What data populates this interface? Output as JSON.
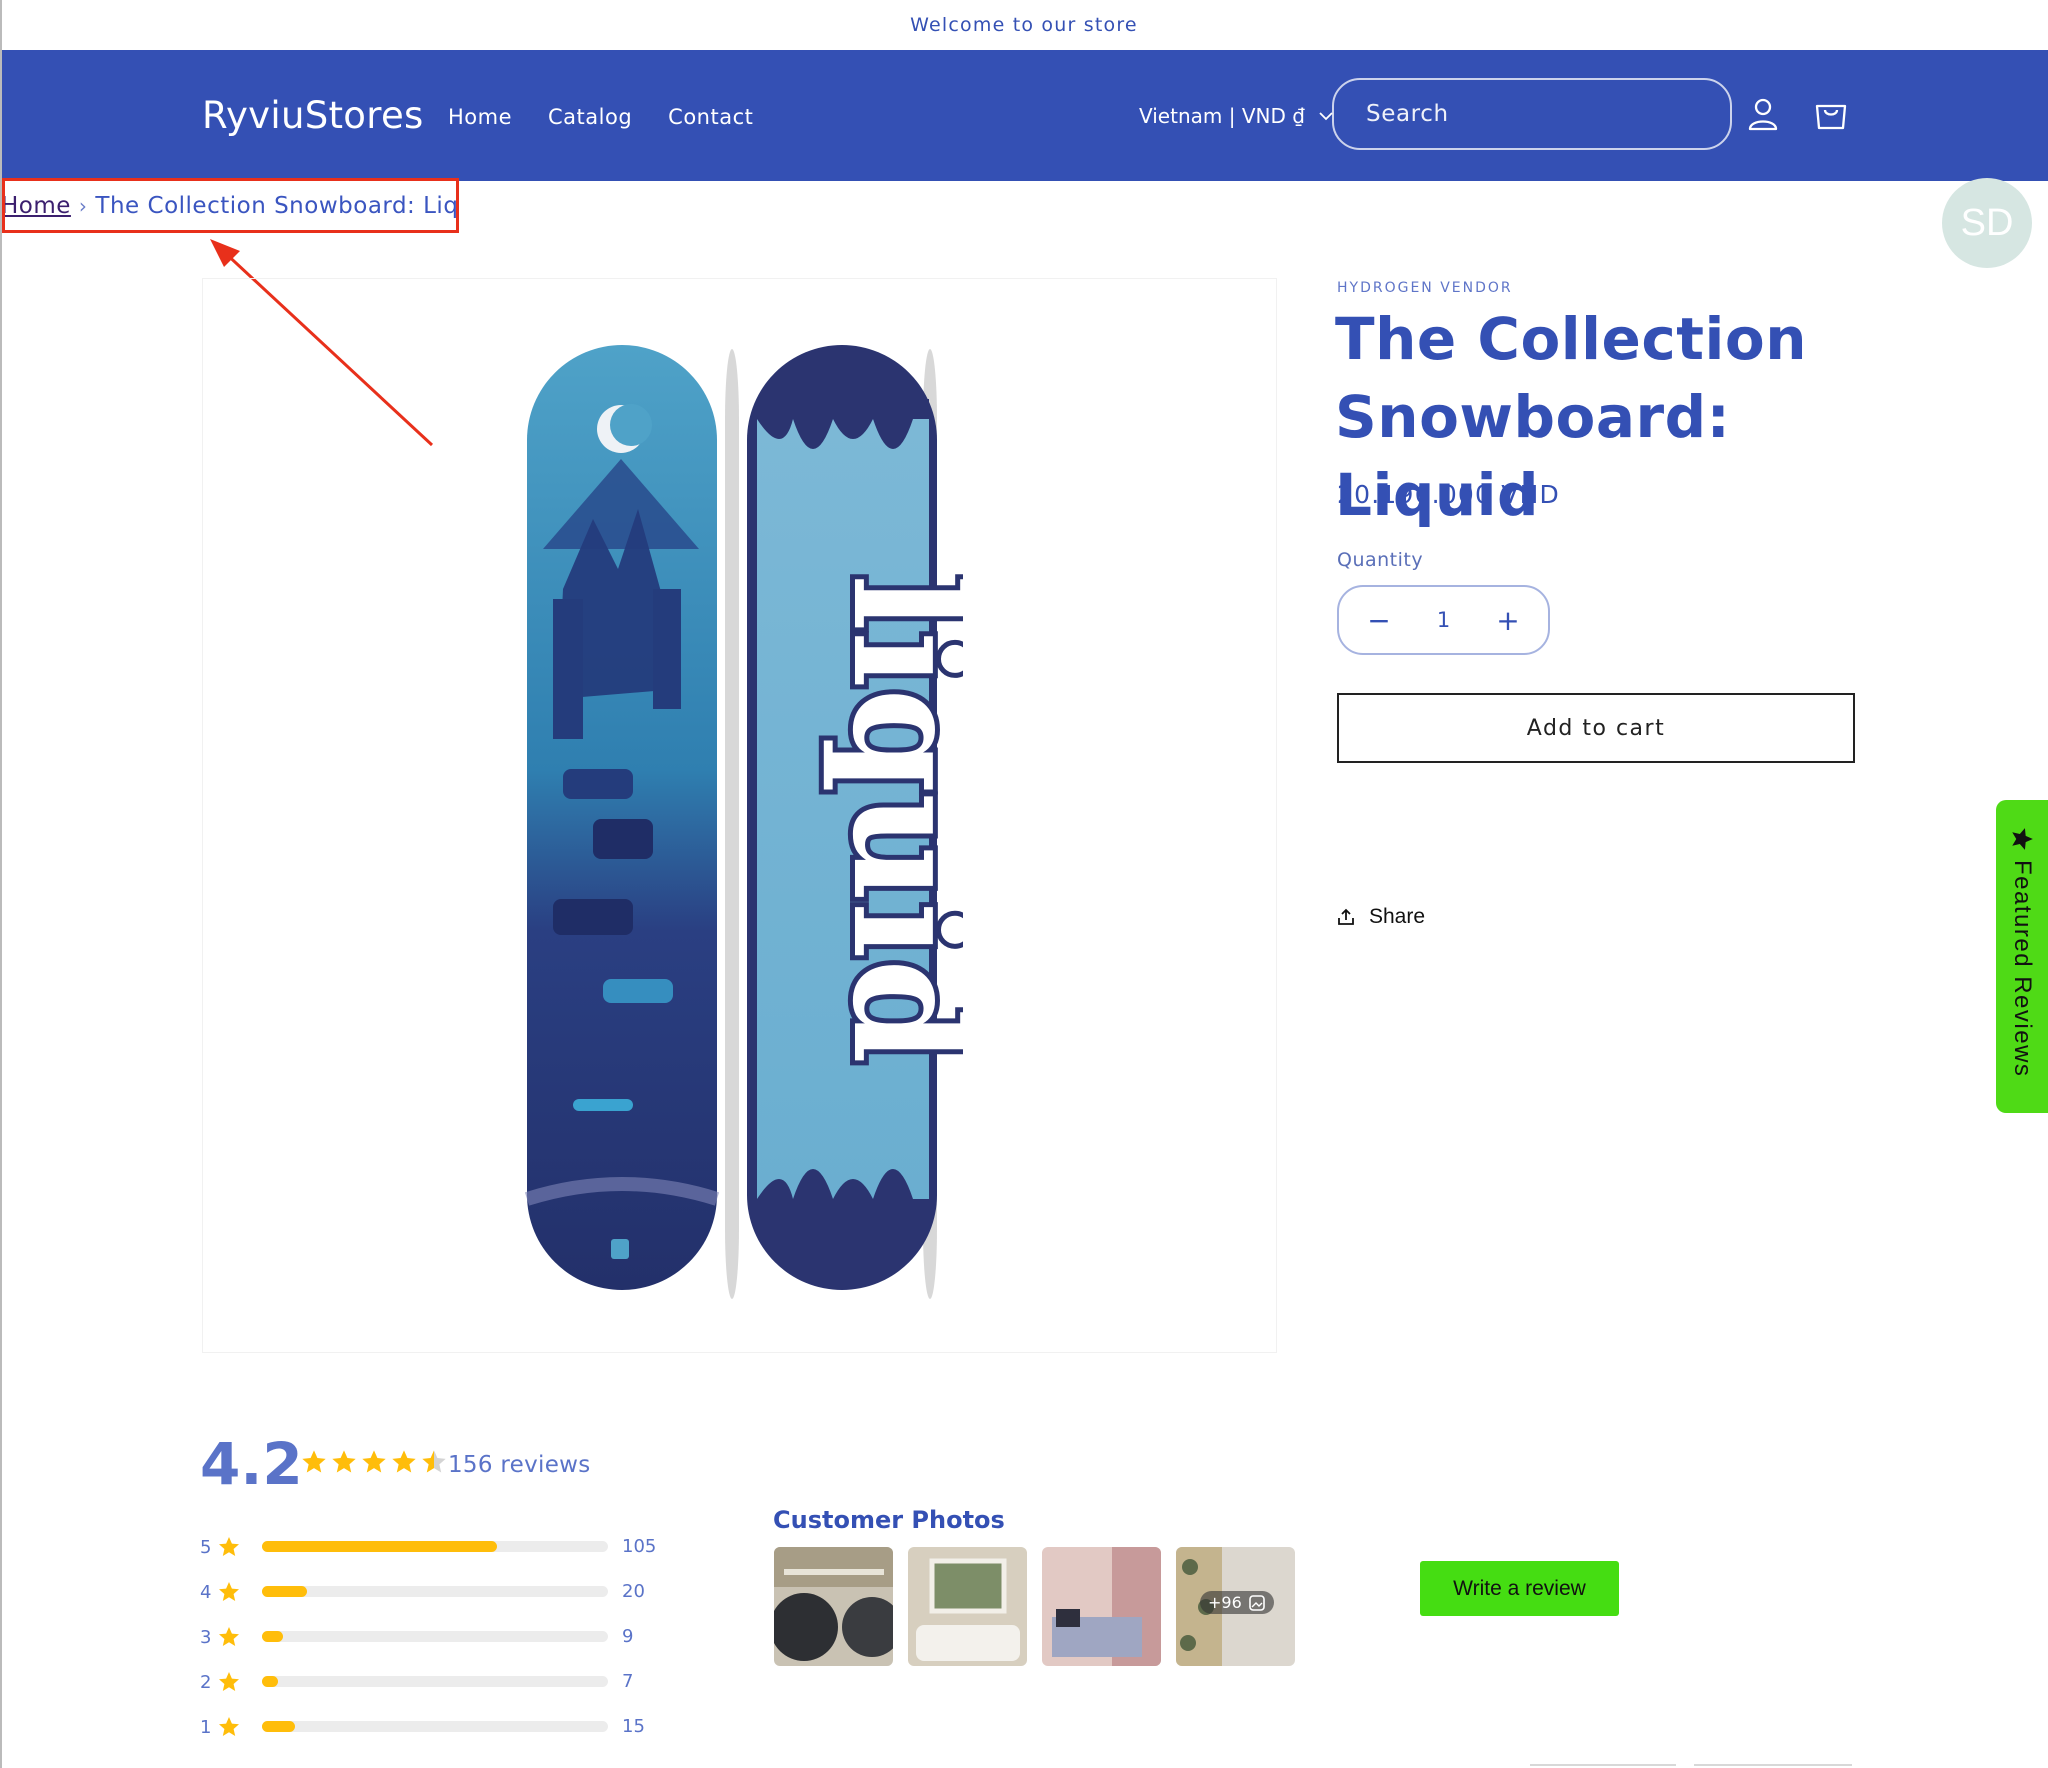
{
  "announcement": "Welcome to our store",
  "header": {
    "logo": "RyviuStores",
    "nav": [
      "Home",
      "Catalog",
      "Contact"
    ],
    "locale": "Vietnam | VND ₫",
    "search_placeholder": "Search",
    "icons": [
      "account-icon",
      "cart-icon"
    ]
  },
  "breadcrumb": {
    "home": "Home",
    "separator": "›",
    "current": "The Collection Snowboard: Liquid"
  },
  "avatar": {
    "initials": "SD"
  },
  "product": {
    "vendor": "HYDROGEN VENDOR",
    "title": "The Collection Snowboard: Liquid",
    "price": "20.196.000 VND",
    "quantity_label": "Quantity",
    "quantity_value": "1",
    "minus": "−",
    "plus": "+",
    "add_to_cart": "Add to cart",
    "share": "Share",
    "board_word": "liquid"
  },
  "featured_tab": "Featured Reviews",
  "reviews": {
    "average": "4.2",
    "average_value": 4.2,
    "count_label": "156 reviews",
    "distribution": [
      {
        "stars": "5",
        "count": "105",
        "fraction": 0.68
      },
      {
        "stars": "4",
        "count": "20",
        "fraction": 0.13
      },
      {
        "stars": "3",
        "count": "9",
        "fraction": 0.06
      },
      {
        "stars": "2",
        "count": "7",
        "fraction": 0.045
      },
      {
        "stars": "1",
        "count": "15",
        "fraction": 0.096
      }
    ],
    "customer_photos_title": "Customer Photos",
    "more_photos": "+96",
    "write_review": "Write a review"
  },
  "colors": {
    "brand": "#3450b4",
    "star": "#ffbd0a",
    "green": "#45dd12",
    "annotation": "#e8301b"
  }
}
